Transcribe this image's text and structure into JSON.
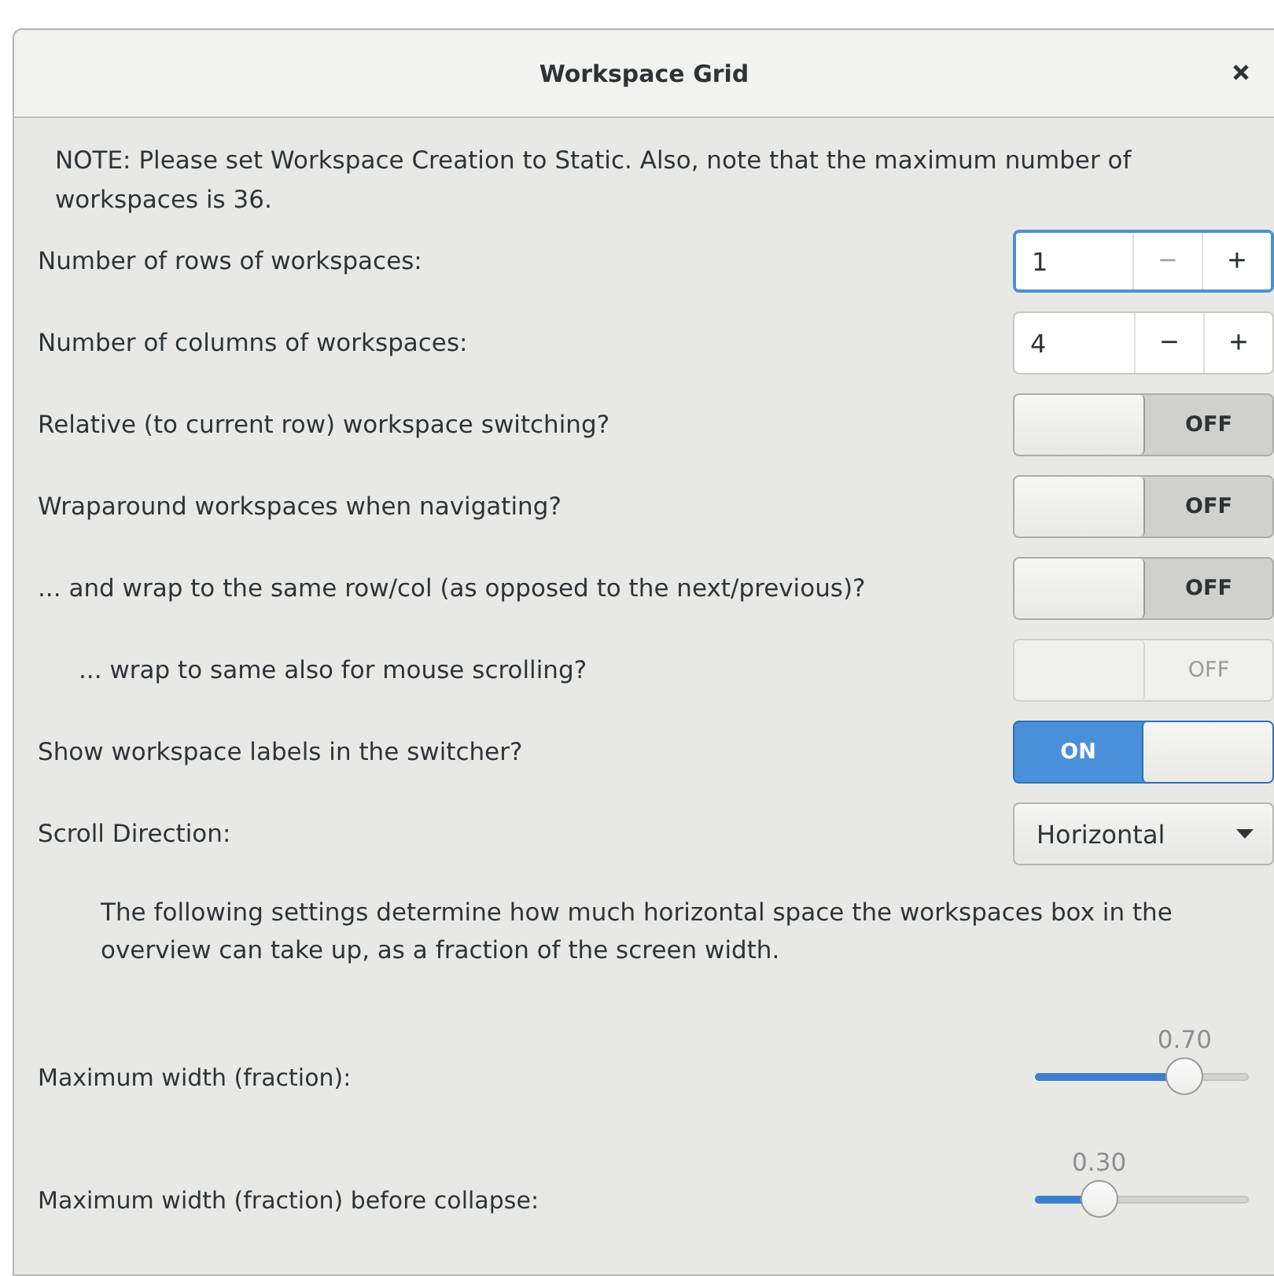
{
  "window": {
    "title": "Workspace Grid"
  },
  "note": "NOTE: Please set Workspace Creation to Static. Also, note that the maximum number of workspaces is 36.",
  "rows": [
    {
      "kind": "spin",
      "label": "Number of rows of workspaces:",
      "value": "1",
      "focused": true,
      "minus_disabled": true,
      "minus": "−",
      "plus": "+"
    },
    {
      "kind": "spin",
      "label": "Number of columns of workspaces:",
      "value": "4",
      "focused": false,
      "minus_disabled": false,
      "minus": "−",
      "plus": "+"
    },
    {
      "kind": "switch",
      "label": "Relative (to current row) workspace switching?",
      "on": false,
      "disabled": false,
      "state_text": "OFF"
    },
    {
      "kind": "switch",
      "label": "Wraparound workspaces when navigating?",
      "on": false,
      "disabled": false,
      "state_text": "OFF"
    },
    {
      "kind": "switch",
      "label": "... and wrap to the same row/col (as opposed to the next/previous)?",
      "on": false,
      "disabled": false,
      "state_text": "OFF",
      "children": [
        {
          "kind": "switch",
          "label": "... wrap to same also for mouse scrolling?",
          "on": false,
          "disabled": true,
          "state_text": "OFF"
        }
      ]
    },
    {
      "kind": "switch",
      "label": "Show workspace labels in the switcher?",
      "on": true,
      "disabled": false,
      "state_text": "ON"
    },
    {
      "kind": "combo",
      "label": "Scroll Direction:",
      "value": "Horizontal"
    },
    {
      "kind": "text",
      "text": "The following settings determine how much horizontal space the workspaces box in the overview can take up, as a fraction of the screen width."
    },
    {
      "kind": "slider",
      "label": "Maximum width (fraction):",
      "reading": "0.70",
      "level": 0.7
    },
    {
      "kind": "slider",
      "label": "Maximum width (fraction) before collapse:",
      "reading": "0.30",
      "level": 0.3
    }
  ]
}
